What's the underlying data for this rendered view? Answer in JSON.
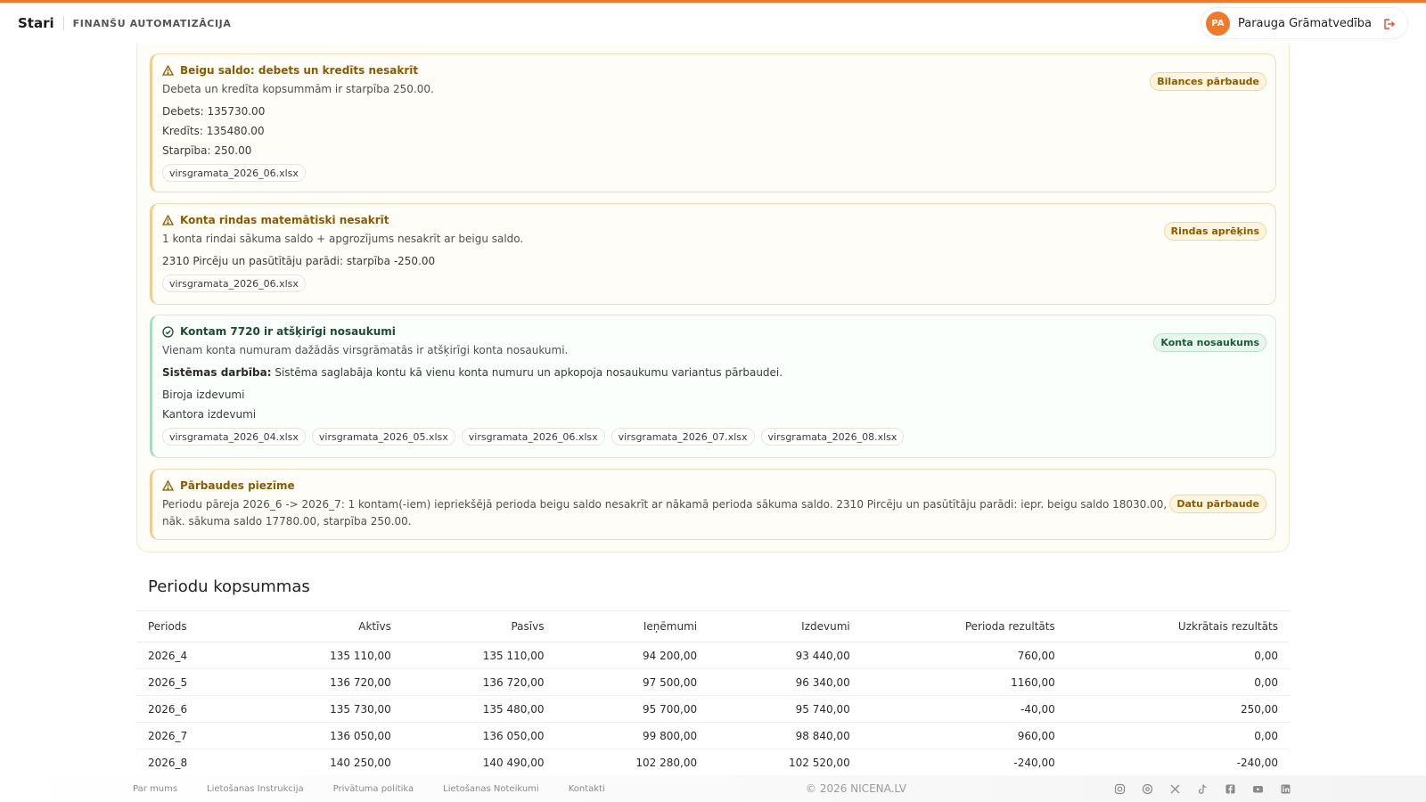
{
  "header": {
    "brand": "Stari",
    "subtitle": "FINANŠU AUTOMATIZĀCIJA",
    "avatar_initials": "PA",
    "user_name": "Parauga Grāmatvedība",
    "accent_color": "#f07a2a"
  },
  "cards": [
    {
      "title": "Beigu saldo: debets un kredīts nesakrīt",
      "description": "Debeta un kredīta kopsummām ir starpība 250.00.",
      "tag": "Bilances pārbaude",
      "lines": [
        "Debets: 135730.00",
        "Kredīts: 135480.00",
        "Starpība: 250.00"
      ],
      "files": [
        "virsgramata_2026_06.xlsx"
      ]
    },
    {
      "title": "Konta rindas matemātiski nesakrīt",
      "description": "1 konta rindai sākuma saldo + apgrozījums nesakrīt ar beigu saldo.",
      "tag": "Rindas aprēķins",
      "lines": [
        "2310 Pircēju un pasūtītāju parādi: starpība -250.00"
      ],
      "files": [
        "virsgramata_2026_06.xlsx"
      ]
    },
    {
      "title": "Kontam 7720 ir atšķirīgi nosaukumi",
      "description": "Vienam konta numuram dažādās virsgrāmatās ir atšķirīgi konta nosaukumi.",
      "tag": "Konta nosaukums",
      "system_label": "Sistēmas darbība:",
      "system_text": "Sistēma saglabāja kontu kā vienu konta numuru un apkopoja nosaukumu variantus pārbaudei.",
      "lines": [
        "Biroja izdevumi",
        "Kantora izdevumi"
      ],
      "files": [
        "virsgramata_2026_04.xlsx",
        "virsgramata_2026_05.xlsx",
        "virsgramata_2026_06.xlsx",
        "virsgramata_2026_07.xlsx",
        "virsgramata_2026_08.xlsx"
      ]
    },
    {
      "title": "Pārbaudes piezīme",
      "description": "Periodu pāreja 2026_6 -> 2026_7: 1 kontam(-iem) iepriekšējā perioda beigu saldo nesakrīt ar nākamā perioda sākuma saldo. 2310 Pircēju un pasūtītāju parādi: iepr. beigu saldo 18030.00, nāk. sākuma saldo 17780.00, starpība 250.00.",
      "tag": "Datu pārbaude"
    }
  ],
  "totals": {
    "title": "Periodu kopsummas",
    "columns": [
      "Periods",
      "Aktīvs",
      "Pasīvs",
      "Ieņēmumi",
      "Izdevumi",
      "Perioda rezultāts",
      "Uzkrātais rezultāts"
    ],
    "rows": [
      [
        "2026_4",
        "135 110,00",
        "135 110,00",
        "94 200,00",
        "93 440,00",
        "760,00",
        "0,00"
      ],
      [
        "2026_5",
        "136 720,00",
        "136 720,00",
        "97 500,00",
        "96 340,00",
        "1160,00",
        "0,00"
      ],
      [
        "2026_6",
        "135 730,00",
        "135 480,00",
        "95 700,00",
        "95 740,00",
        "-40,00",
        "250,00"
      ],
      [
        "2026_7",
        "136 050,00",
        "136 050,00",
        "99 800,00",
        "98 840,00",
        "960,00",
        "0,00"
      ],
      [
        "2026_8",
        "140 250,00",
        "140 490,00",
        "102 280,00",
        "102 520,00",
        "-240,00",
        "-240,00"
      ]
    ],
    "negative_color": "#d4242c"
  },
  "footer": {
    "links": [
      "Par mums",
      "Lietošanas Instrukcija",
      "Privātuma politika",
      "Lietošanas Noteikumi",
      "Kontakti"
    ],
    "copyright": "© 2026 NICENA.LV",
    "socials": [
      "instagram-icon",
      "threads-icon",
      "x-icon",
      "tiktok-icon",
      "facebook-icon",
      "youtube-icon",
      "linkedin-icon"
    ]
  }
}
